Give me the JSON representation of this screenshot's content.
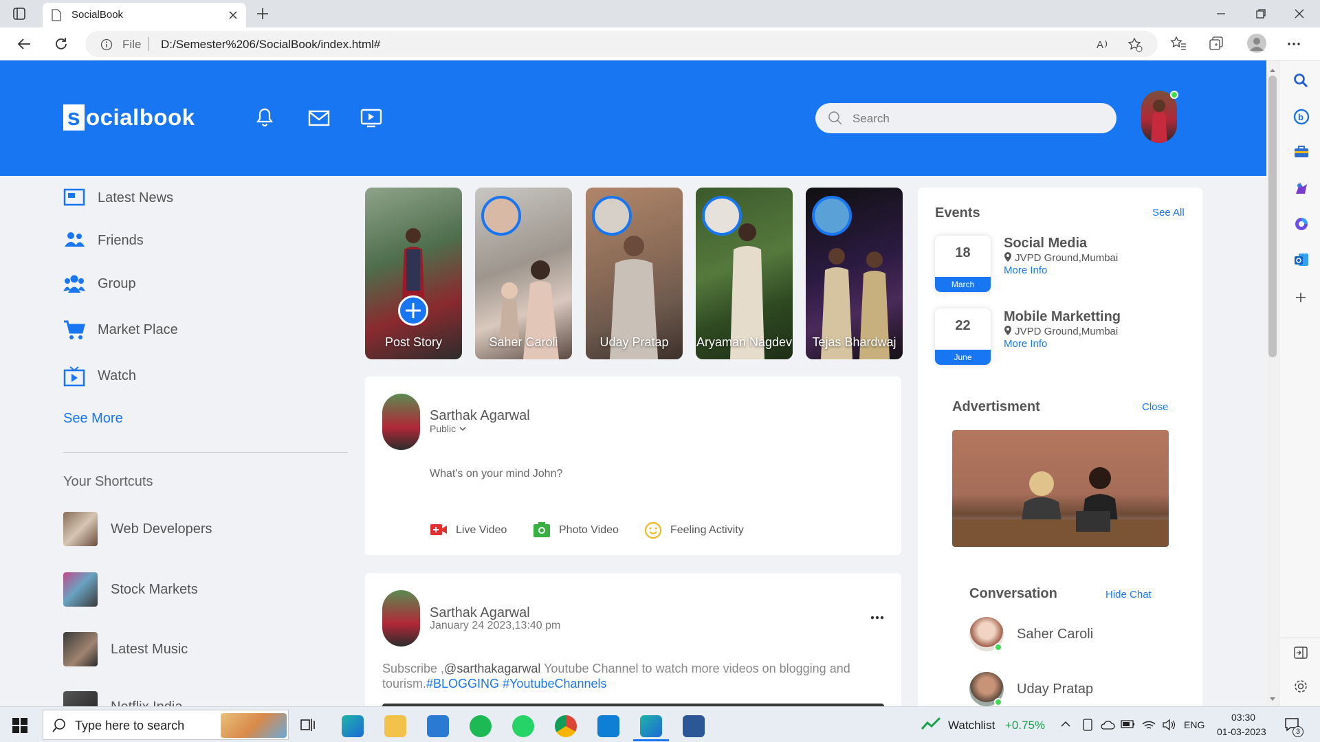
{
  "browser": {
    "tab_title": "SocialBook",
    "url_prefix": "File",
    "url": "D:/Semester%206/SocialBook/index.html#"
  },
  "navbar": {
    "logo_initial": "s",
    "logo_rest": "ocialbook",
    "search_placeholder": "Search"
  },
  "sidebar": {
    "items": [
      {
        "label": "Latest News",
        "icon": "newspaper-icon"
      },
      {
        "label": "Friends",
        "icon": "friends-icon"
      },
      {
        "label": "Group",
        "icon": "group-icon"
      },
      {
        "label": "Market Place",
        "icon": "cart-icon"
      },
      {
        "label": "Watch",
        "icon": "watch-icon"
      }
    ],
    "see_more": "See More",
    "shortcuts_title": "Your Shortcuts",
    "shortcuts": [
      "Web Developers",
      "Stock Markets",
      "Latest Music",
      "Netflix India"
    ]
  },
  "stories": [
    {
      "name": "Post Story"
    },
    {
      "name": "Saher Caroli"
    },
    {
      "name": "Uday Pratap"
    },
    {
      "name": "Aryaman Nagdev"
    },
    {
      "name": "Tejas Bhardwaj"
    }
  ],
  "composer": {
    "user_name": "Sarthak Agarwal",
    "privacy": "Public",
    "placeholder": "What's on your mind John?",
    "actions": [
      "Live Video",
      "Photo Video",
      "Feeling Activity"
    ]
  },
  "post": {
    "user_name": "Sarthak Agarwal",
    "timestamp": "January 24 2023,13:40 pm",
    "text_1": "Subscribe ,",
    "mention": "@sarthakagarwal",
    "text_2": " Youtube Channel to watch more videos on blogging and tourism.",
    "tag_1": "#BLOGGING",
    "tag_2": "#YoutubeChannels"
  },
  "events": {
    "title": "Events",
    "see_all": "See All",
    "list": [
      {
        "day": "18",
        "month": "March",
        "name": "Social Media",
        "location": "JVPD Ground,Mumbai",
        "link": "More Info"
      },
      {
        "day": "22",
        "month": "June",
        "name": "Mobile Marketting",
        "location": "JVPD Ground,Mumbai",
        "link": "More Info"
      }
    ]
  },
  "ad": {
    "title": "Advertisment",
    "close": "Close"
  },
  "conversation": {
    "title": "Conversation",
    "hide": "Hide Chat",
    "contacts": [
      "Saher Caroli",
      "Uday Pratap"
    ]
  },
  "taskbar": {
    "search_placeholder": "Type here to search",
    "watchlist_label": "Watchlist",
    "watchlist_change": "+0.75%",
    "language": "ENG",
    "time": "03:30",
    "date": "01-03-2023",
    "notifications": "3"
  },
  "colors": {
    "brand": "#1876f2",
    "green": "#41db51"
  }
}
